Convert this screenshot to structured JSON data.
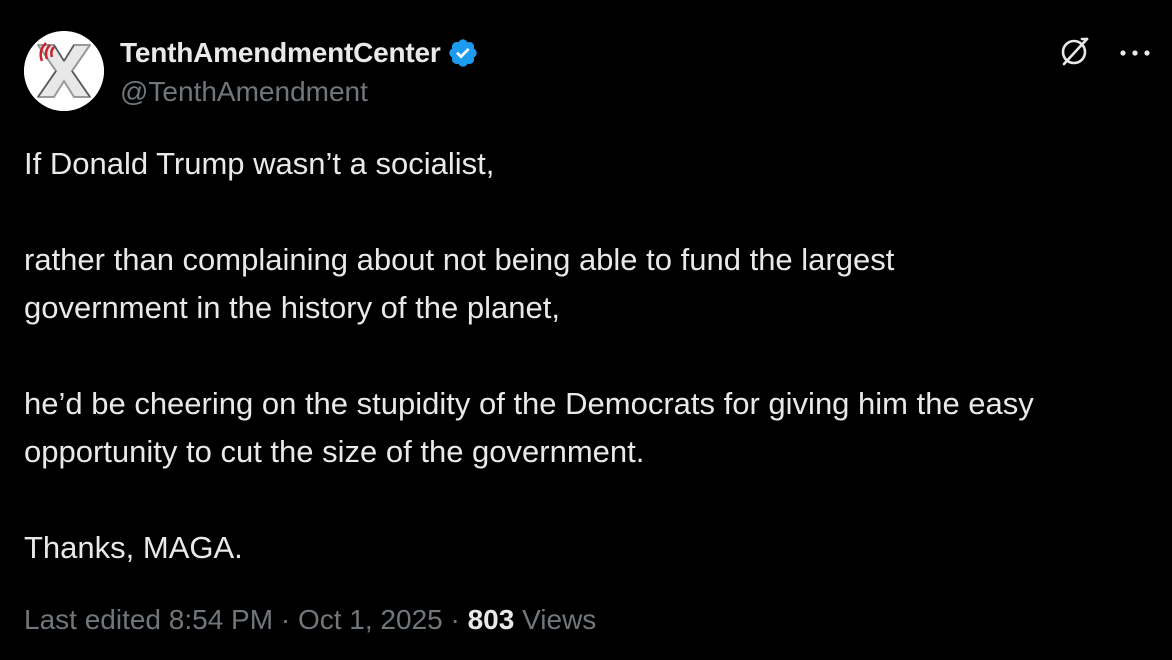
{
  "author": {
    "display_name": "TenthAmendmentCenter",
    "handle": "@TenthAmendment",
    "verified": true,
    "verified_color": "#1d9bf0"
  },
  "icons": {
    "grok": "grok-icon",
    "more": "more-icon",
    "verified": "verified-badge-icon"
  },
  "tweet": {
    "paragraphs": [
      "If Donald Trump wasn’t a socialist,",
      "rather than complaining about not being able to fund the largest government in the history of the planet,",
      "he’d be cheering on the stupidity of the Democrats for giving him the easy opportunity to cut the size of the government.",
      "Thanks, MAGA."
    ]
  },
  "meta": {
    "edited_prefix": "Last edited",
    "time": "8:54 PM",
    "separator": "·",
    "date": "Oct 1, 2025",
    "views_count": "803",
    "views_label": "Views"
  },
  "colors": {
    "background": "#000000",
    "text": "#e7e9ea",
    "secondary": "#71767b",
    "accent": "#1d9bf0"
  }
}
